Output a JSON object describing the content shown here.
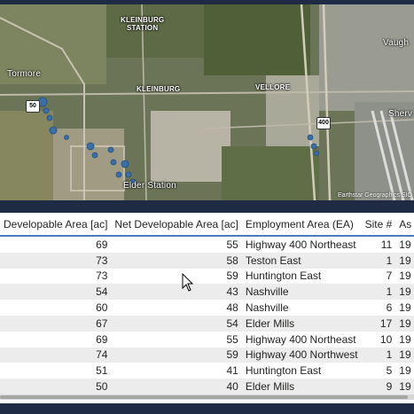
{
  "map": {
    "labels": {
      "kleinburg_station": "KLEINBURG\nSTATION",
      "tormore": "Tormore",
      "kleinburg": "KLEINBURG",
      "vellore": "VELLORE",
      "vaughan": "Vaugh",
      "sherwood": "Sherv",
      "elder_station": "Elder Station"
    },
    "shields": {
      "hwy50": "50",
      "hwy400": "400"
    },
    "attribution": "Earthstar Geographics SIO",
    "marker_color": "#3a6fa8"
  },
  "table": {
    "columns": [
      "Developable Area [ac]",
      "Net Developable Area [ac]",
      "Employment Area (EA)",
      "Site #",
      "As"
    ],
    "rows": [
      {
        "dev": "69",
        "net": "55",
        "ea": "Highway 400 Northeast",
        "site": "11",
        "as": "19"
      },
      {
        "dev": "73",
        "net": "58",
        "ea": "Teston East",
        "site": "1",
        "as": "19"
      },
      {
        "dev": "73",
        "net": "59",
        "ea": "Huntington East",
        "site": "7",
        "as": "19"
      },
      {
        "dev": "54",
        "net": "43",
        "ea": "Nashville",
        "site": "1",
        "as": "19"
      },
      {
        "dev": "60",
        "net": "48",
        "ea": "Nashville",
        "site": "6",
        "as": "19"
      },
      {
        "dev": "67",
        "net": "54",
        "ea": "Elder Mills",
        "site": "17",
        "as": "19"
      },
      {
        "dev": "69",
        "net": "55",
        "ea": "Highway 400 Northeast",
        "site": "10",
        "as": "19"
      },
      {
        "dev": "74",
        "net": "59",
        "ea": "Highway 400 Northwest",
        "site": "1",
        "as": "19"
      },
      {
        "dev": "51",
        "net": "41",
        "ea": "Huntington East",
        "site": "5",
        "as": "19"
      },
      {
        "dev": "50",
        "net": "40",
        "ea": "Elder Mills",
        "site": "9",
        "as": "19"
      }
    ]
  },
  "colors": {
    "header_underline": "#4a7ebb",
    "frame": "#1f2a44",
    "alt_row": "#ececec"
  }
}
